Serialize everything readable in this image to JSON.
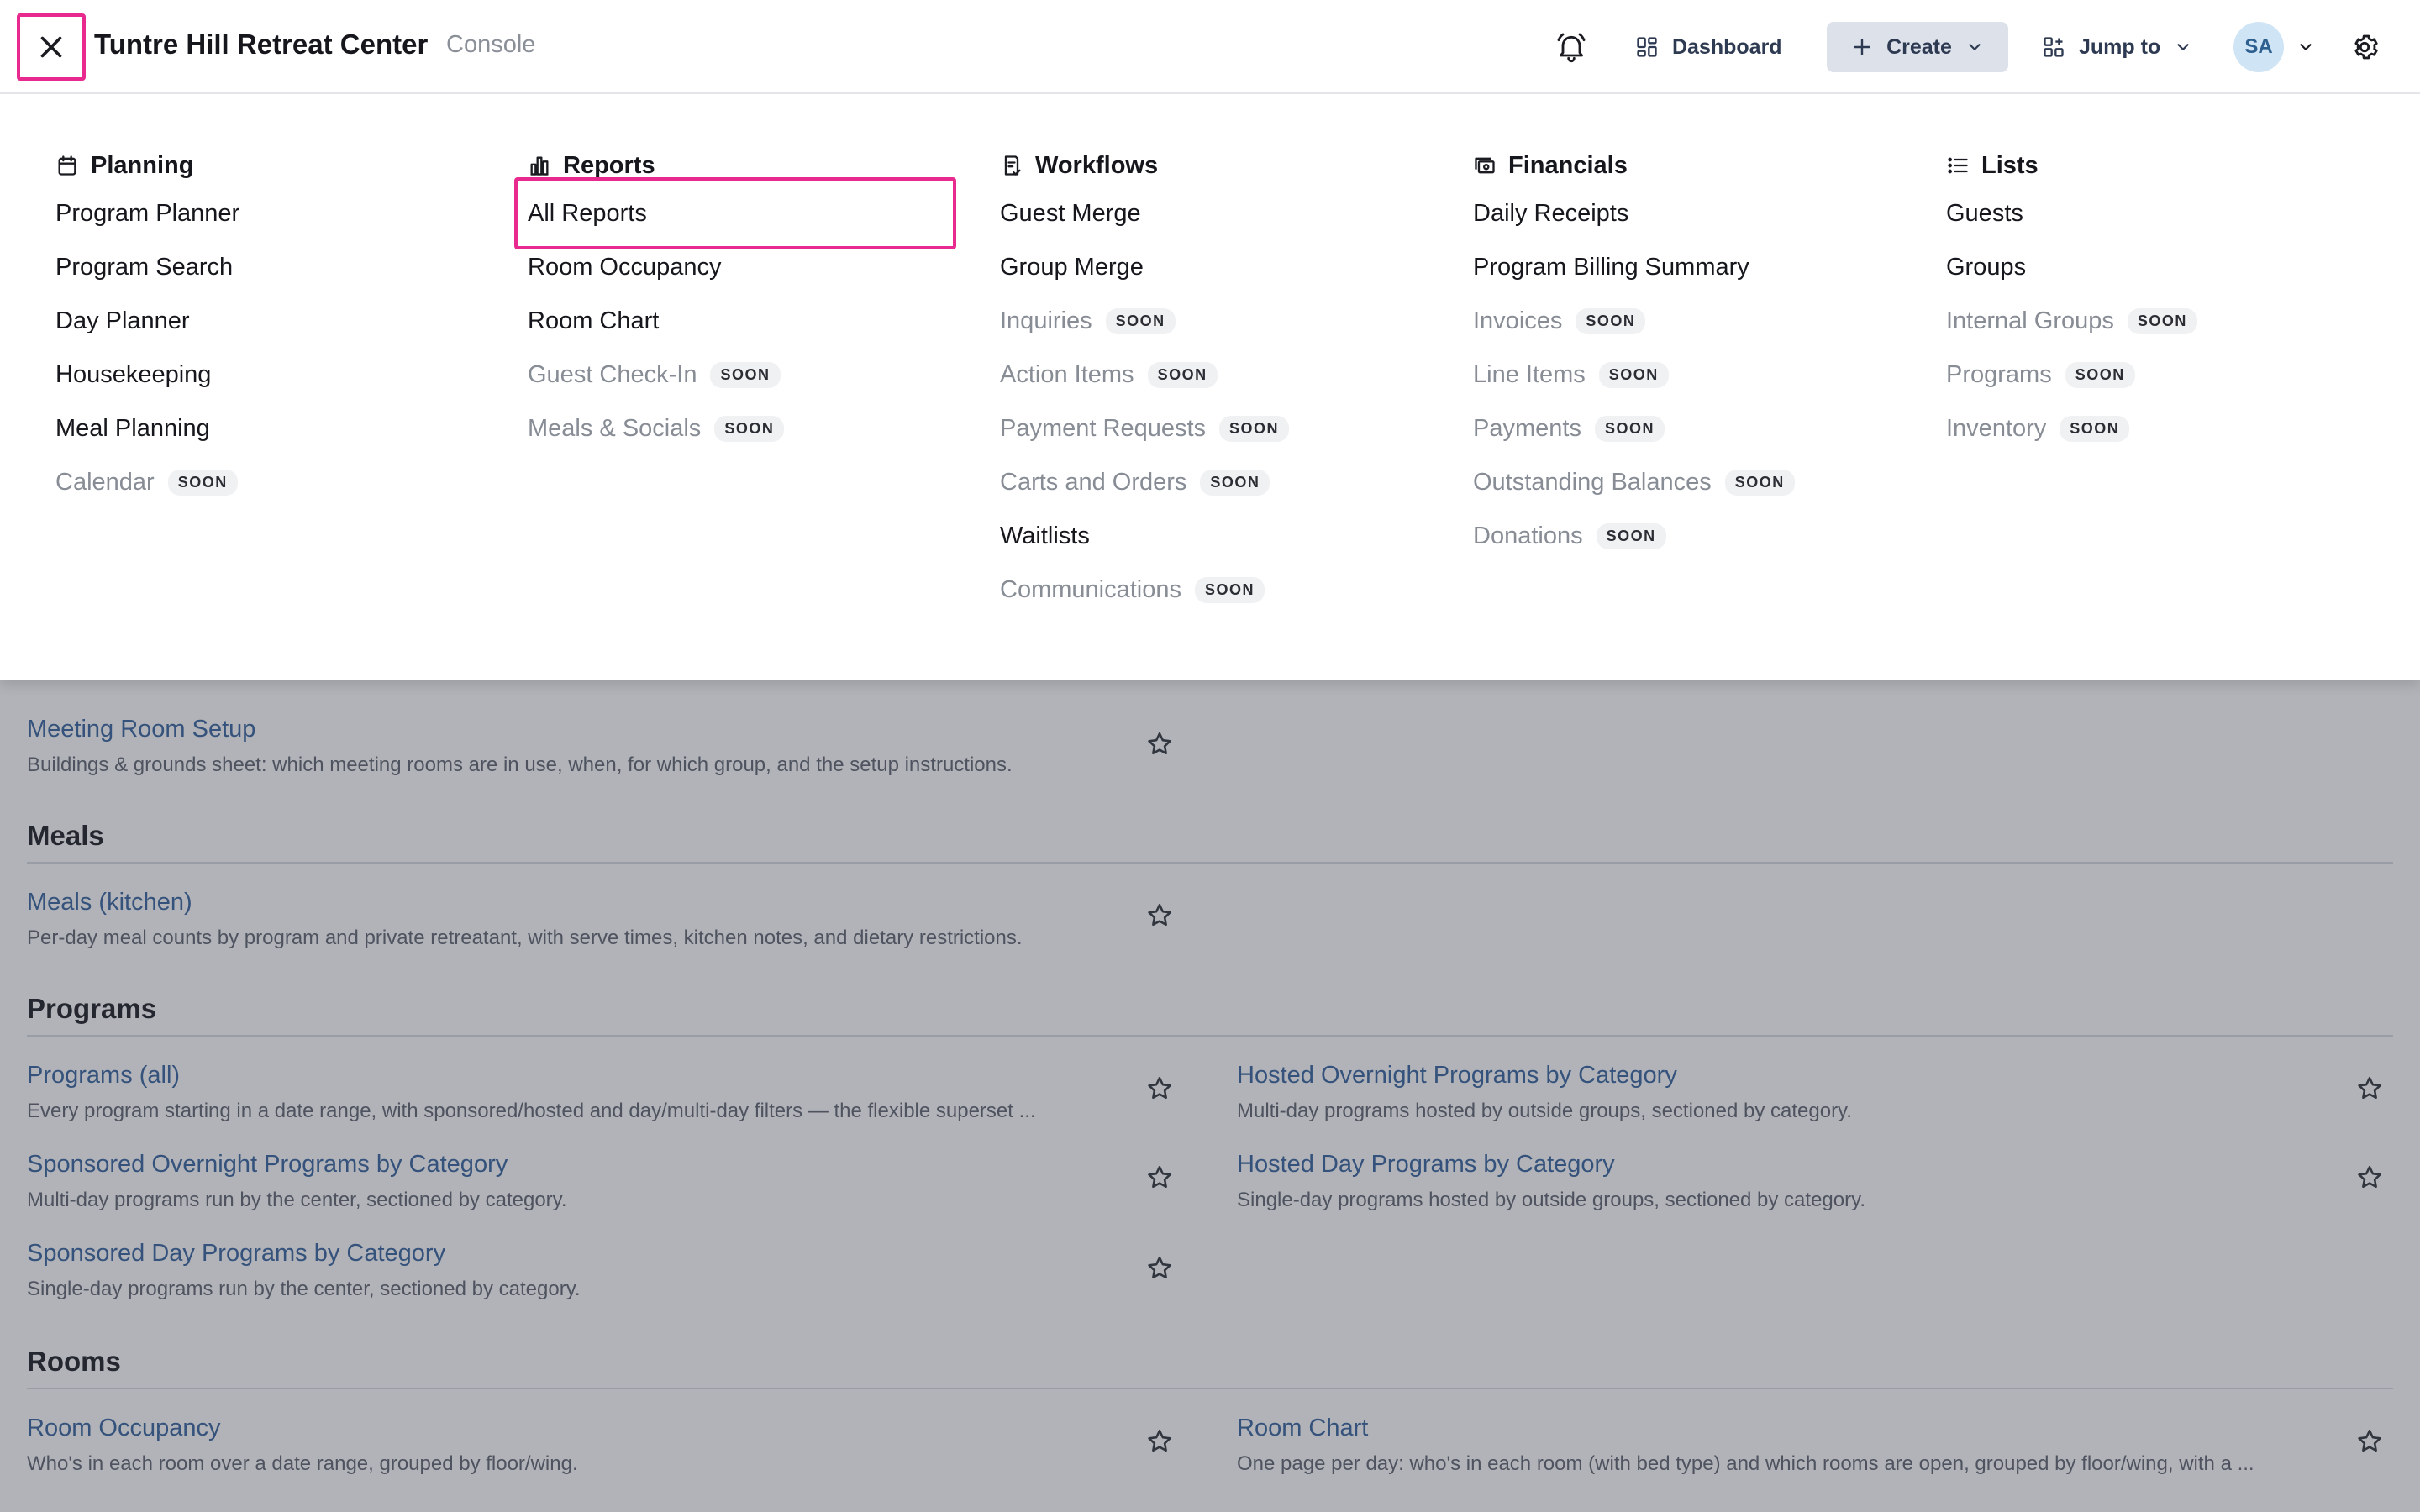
{
  "header": {
    "title": "Tuntre Hill Retreat Center",
    "subtitle": "Console",
    "dashboard_label": "Dashboard",
    "create_label": "Create",
    "jump_label": "Jump to",
    "avatar_initials": "SA"
  },
  "menu": {
    "soon_label": "SOON",
    "columns": [
      {
        "heading": "Planning",
        "icon": "calendar-icon",
        "items": [
          {
            "label": "Program Planner"
          },
          {
            "label": "Program Search"
          },
          {
            "label": "Day Planner"
          },
          {
            "label": "Housekeeping"
          },
          {
            "label": "Meal Planning"
          },
          {
            "label": "Calendar",
            "soon": true
          }
        ]
      },
      {
        "heading": "Reports",
        "icon": "chart-icon",
        "items": [
          {
            "label": "All Reports",
            "highlighted": true
          },
          {
            "label": "Room Occupancy"
          },
          {
            "label": "Room Chart"
          },
          {
            "label": "Guest Check-In",
            "soon": true
          },
          {
            "label": "Meals & Socials",
            "soon": true
          }
        ]
      },
      {
        "heading": "Workflows",
        "icon": "clipboard-icon",
        "items": [
          {
            "label": "Guest Merge"
          },
          {
            "label": "Group Merge"
          },
          {
            "label": "Inquiries",
            "soon": true
          },
          {
            "label": "Action Items",
            "soon": true
          },
          {
            "label": "Payment Requests",
            "soon": true
          },
          {
            "label": "Carts and Orders",
            "soon": true
          },
          {
            "label": "Waitlists"
          },
          {
            "label": "Communications",
            "soon": true
          }
        ]
      },
      {
        "heading": "Financials",
        "icon": "money-icon",
        "items": [
          {
            "label": "Daily Receipts"
          },
          {
            "label": "Program Billing Summary"
          },
          {
            "label": "Invoices",
            "soon": true
          },
          {
            "label": "Line Items",
            "soon": true
          },
          {
            "label": "Payments",
            "soon": true
          },
          {
            "label": "Outstanding Balances",
            "soon": true
          },
          {
            "label": "Donations",
            "soon": true
          }
        ]
      },
      {
        "heading": "Lists",
        "icon": "list-icon",
        "items": [
          {
            "label": "Guests"
          },
          {
            "label": "Groups"
          },
          {
            "label": "Internal Groups",
            "soon": true
          },
          {
            "label": "Programs",
            "soon": true
          },
          {
            "label": "Inventory",
            "soon": true
          }
        ]
      }
    ]
  },
  "content": {
    "meeting_room_setup": {
      "name": "Meeting Room Setup",
      "desc": "Buildings & grounds sheet: which meeting rooms are in use, when, for which group, and the setup instructions."
    },
    "meals_section": "Meals",
    "meals_kitchen": {
      "name": "Meals (kitchen)",
      "desc": "Per-day meal counts by program and private retreatant, with serve times, kitchen notes, and dietary restrictions."
    },
    "programs_section": "Programs",
    "programs_all": {
      "name": "Programs (all)",
      "desc": "Every program starting in a date range, with sponsored/hosted and day/multi-day filters — the flexible superset ..."
    },
    "hosted_overnight": {
      "name": "Hosted Overnight Programs by Category",
      "desc": "Multi-day programs hosted by outside groups, sectioned by category."
    },
    "sponsored_overnight": {
      "name": "Sponsored Overnight Programs by Category",
      "desc": "Multi-day programs run by the center, sectioned by category."
    },
    "hosted_day": {
      "name": "Hosted Day Programs by Category",
      "desc": "Single-day programs hosted by outside groups, sectioned by category."
    },
    "sponsored_day": {
      "name": "Sponsored Day Programs by Category",
      "desc": "Single-day programs run by the center, sectioned by category."
    },
    "rooms_section": "Rooms",
    "room_occupancy": {
      "name": "Room Occupancy",
      "desc": "Who's in each room over a date range, grouped by floor/wing."
    },
    "room_chart": {
      "name": "Room Chart",
      "desc": "One page per day: who's in each room (with bed type) and which rooms are open, grouped by floor/wing, with a ..."
    }
  }
}
